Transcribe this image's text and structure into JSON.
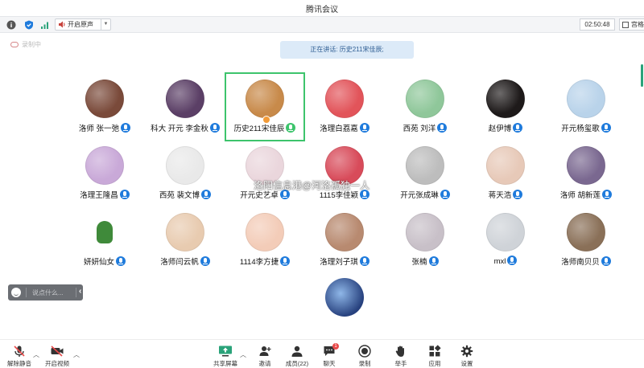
{
  "window": {
    "title": "腾讯会议"
  },
  "toolbar": {
    "original_sound_label": "开启原声",
    "timer": "02:50:48",
    "gallery_label": "宫格"
  },
  "recording": {
    "label": "录制中"
  },
  "speaking": {
    "text": "正在讲话: 历史211宋佳辰;"
  },
  "colors": {
    "accent_green": "#3dc46c",
    "mic_blue": "#1f7bdc",
    "speaking_bg": "#dceaf8"
  },
  "participants": [
    {
      "name": "洛师 张一弛",
      "color": "#7a4a3a"
    },
    {
      "name": "科大 开元 李金秋",
      "color": "#5b3f66"
    },
    {
      "name": "历史211宋佳辰",
      "color": "#c88a4a",
      "active": true
    },
    {
      "name": "洛理白荔嘉",
      "color": "#e2545a"
    },
    {
      "name": "西苑 刘洋",
      "color": "#8fc79a"
    },
    {
      "name": "赵伊博",
      "color": "#1e1a1a"
    },
    {
      "name": "开元杨玺歌",
      "color": "#b9d3ea"
    },
    {
      "name": "洛理王隆昌",
      "color": "#c9a9d8"
    },
    {
      "name": "西苑 裴文博",
      "color": "#e9e9e9"
    },
    {
      "name": "开元史艺卓",
      "color": "#ead6dc"
    },
    {
      "name": "1115李佳颖",
      "color": "#d84b5a"
    },
    {
      "name": "开元张成琳",
      "color": "#bdbdbd"
    },
    {
      "name": "蒋天浩",
      "color": "#e7c9b8"
    },
    {
      "name": "洛师 胡新莲",
      "color": "#7a6890"
    },
    {
      "name": "妍妍仙女",
      "color": "#ffffff"
    },
    {
      "name": "洛师闫云帆",
      "color": "#e8cbb0"
    },
    {
      "name": "1114李方捷",
      "color": "#f3ccb8"
    },
    {
      "name": "洛理刘子琪",
      "color": "#b88a70"
    },
    {
      "name": "张楠",
      "color": "#c8c0c8"
    },
    {
      "name": "mxl",
      "color": "#cfd3d8"
    },
    {
      "name": "洛师南贝贝",
      "color": "#8a7058"
    }
  ],
  "extra_avatar": {
    "color": "#27417e"
  },
  "watermark": {
    "text": "洛阳信息港@河洛孤独一人"
  },
  "chat": {
    "placeholder": "说点什么..."
  },
  "bottombar": {
    "unmute": "解除静音",
    "start_video": "开启视频",
    "share_screen": "共享屏幕",
    "invite": "邀请",
    "members": "成员(22)",
    "chat": "聊天",
    "chat_badge": "1",
    "record": "录制",
    "raise_hand": "举手",
    "apps": "应用",
    "settings": "设置"
  }
}
